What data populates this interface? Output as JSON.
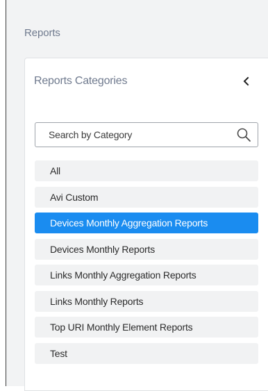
{
  "page": {
    "title": "Reports"
  },
  "panel": {
    "title": "Reports Categories",
    "collapse_icon": "chevron-left-icon"
  },
  "search": {
    "placeholder": "Search by Category",
    "value": "",
    "icon": "search-icon"
  },
  "categories": [
    {
      "label": "All",
      "selected": false
    },
    {
      "label": "Avi Custom",
      "selected": false
    },
    {
      "label": "Devices Monthly Aggregation Reports",
      "selected": true
    },
    {
      "label": "Devices Monthly Reports",
      "selected": false
    },
    {
      "label": "Links Monthly Aggregation Reports",
      "selected": false
    },
    {
      "label": "Links Monthly Reports",
      "selected": false
    },
    {
      "label": "Top URI Monthly Element Reports",
      "selected": false
    },
    {
      "label": "Test",
      "selected": false
    }
  ],
  "colors": {
    "accent": "#1a8cf0",
    "item_bg": "#f1f2f3",
    "muted_text": "#6f7a8e"
  }
}
